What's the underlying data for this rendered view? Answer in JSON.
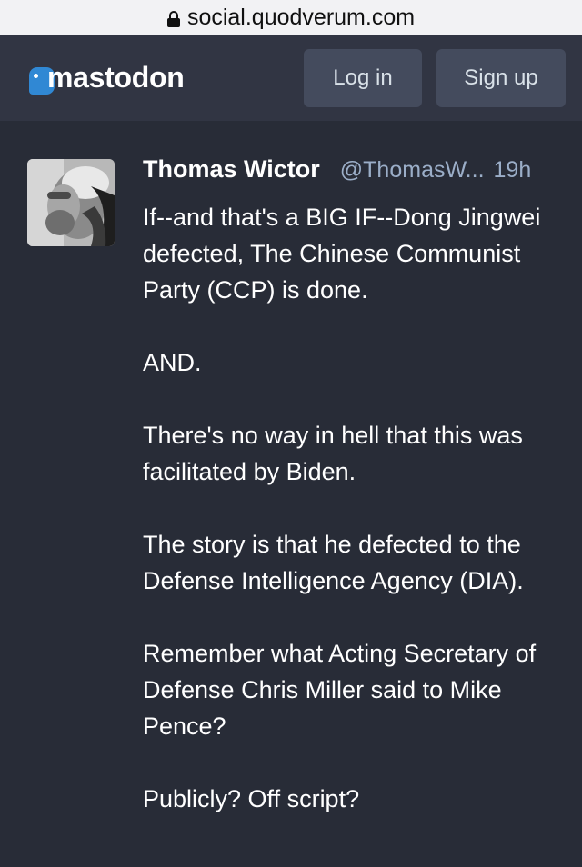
{
  "browser": {
    "url": "social.quodverum.com"
  },
  "header": {
    "logo_text": "mastodon",
    "login_label": "Log in",
    "signup_label": "Sign up"
  },
  "post": {
    "display_name": "Thomas Wictor",
    "handle": "@ThomasW...",
    "time": "19h",
    "paragraphs": [
      "If--and that's a BIG IF--Dong Jingwei defected, The Chinese Communist Party (CCP) is done.",
      "AND.",
      "There's no way in hell that this was facilitated by Biden.",
      "The story is that he defected to the Defense Intelligence Agency (DIA).",
      "Remember what Acting Secretary of Defense Chris Miller said to Mike Pence?",
      "Publicly? Off script?"
    ]
  },
  "colors": {
    "background": "#282c37",
    "header": "#313543",
    "button": "#444b5d",
    "brand": "#3088d4",
    "muted": "#9baec8"
  }
}
